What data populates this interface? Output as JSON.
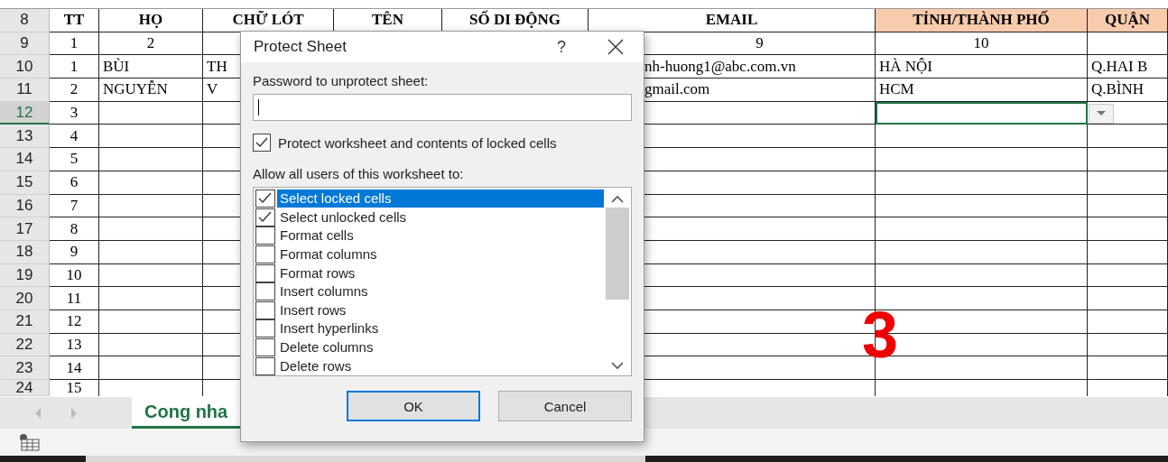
{
  "sheet": {
    "columns": [
      {
        "label": "TT",
        "highlighted": false
      },
      {
        "label": "HỌ",
        "highlighted": false
      },
      {
        "label": "CHỮ LÓT",
        "highlighted": false
      },
      {
        "label": "TÊN",
        "highlighted": false
      },
      {
        "label": "SỐ DI ĐỘNG",
        "highlighted": false
      },
      {
        "label": "EMAIL",
        "highlighted": false
      },
      {
        "label": "TỈNH/THÀNH PHỐ",
        "highlighted": true
      },
      {
        "label": "QUẬN",
        "highlighted": true
      }
    ],
    "header_row_number": "8",
    "rows": [
      {
        "number": "9",
        "selected": false,
        "tt": "1",
        "ho": "2",
        "email": "9",
        "tinh": "10"
      },
      {
        "number": "10",
        "selected": false,
        "tt": "1",
        "ho": "BÙI",
        "chu_lot": "TH",
        "email": "nh-huong1@abc.com.vn",
        "tinh": "HÀ NỘI",
        "quan": "Q.HAI B"
      },
      {
        "number": "11",
        "selected": false,
        "tt": "2",
        "ho": "NGUYỄN",
        "chu_lot": "V",
        "email": "gmail.com",
        "tinh": "HCM",
        "quan": "Q.BÌNH"
      },
      {
        "number": "12",
        "selected": true,
        "tt": "3"
      },
      {
        "number": "13",
        "selected": false,
        "tt": "4"
      },
      {
        "number": "14",
        "selected": false,
        "tt": "5"
      },
      {
        "number": "15",
        "selected": false,
        "tt": "6"
      },
      {
        "number": "16",
        "selected": false,
        "tt": "7"
      },
      {
        "number": "17",
        "selected": false,
        "tt": "8"
      },
      {
        "number": "18",
        "selected": false,
        "tt": "9"
      },
      {
        "number": "19",
        "selected": false,
        "tt": "10"
      },
      {
        "number": "20",
        "selected": false,
        "tt": "11"
      },
      {
        "number": "21",
        "selected": false,
        "tt": "12"
      },
      {
        "number": "22",
        "selected": false,
        "tt": "13"
      },
      {
        "number": "23",
        "selected": false,
        "tt": "14"
      },
      {
        "number": "24",
        "selected": false,
        "tt": "15"
      }
    ]
  },
  "annotation": "3",
  "sheet_tabs": [
    {
      "label": "Cong nha",
      "selected": true
    }
  ],
  "dialog": {
    "title": "Protect Sheet",
    "help": "?",
    "password_label": "Password to unprotect sheet:",
    "protect": {
      "label": "Protect worksheet and contents of locked cells",
      "checked": true
    },
    "allow_label": "Allow all users of this worksheet to:",
    "options": [
      {
        "label": "Select locked cells",
        "checked": true,
        "selected": true
      },
      {
        "label": "Select unlocked cells",
        "checked": true,
        "selected": false
      },
      {
        "label": "Format cells",
        "checked": false,
        "selected": false
      },
      {
        "label": "Format columns",
        "checked": false,
        "selected": false
      },
      {
        "label": "Format rows",
        "checked": false,
        "selected": false
      },
      {
        "label": "Insert columns",
        "checked": false,
        "selected": false
      },
      {
        "label": "Insert rows",
        "checked": false,
        "selected": false
      },
      {
        "label": "Insert hyperlinks",
        "checked": false,
        "selected": false
      },
      {
        "label": "Delete columns",
        "checked": false,
        "selected": false
      },
      {
        "label": "Delete rows",
        "checked": false,
        "selected": false
      }
    ],
    "buttons": [
      {
        "label": "OK",
        "default": true
      },
      {
        "label": "Cancel",
        "default": false
      }
    ]
  }
}
